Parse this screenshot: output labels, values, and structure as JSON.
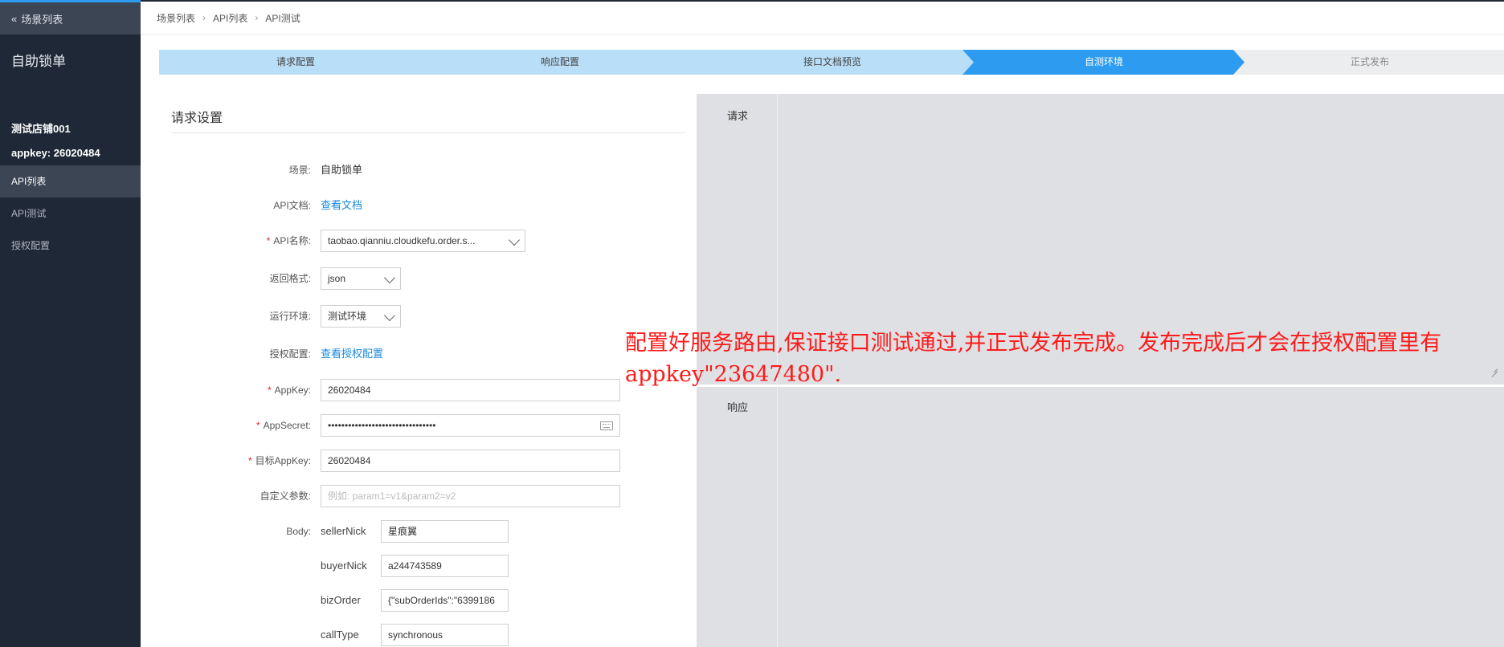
{
  "sidebar": {
    "back_label": "场景列表",
    "scene_title": "自助锁单",
    "store_name": "测试店铺001",
    "appkey_text": "appkey: 26020484",
    "items": [
      {
        "label": "API列表",
        "active": true
      },
      {
        "label": "API测试",
        "active": false
      },
      {
        "label": "授权配置",
        "active": false
      }
    ]
  },
  "breadcrumb": [
    "场景列表",
    "API列表",
    "API测试"
  ],
  "steps": [
    {
      "label": "请求配置",
      "state": "done"
    },
    {
      "label": "响应配置",
      "state": "done"
    },
    {
      "label": "接口文档预览",
      "state": "done"
    },
    {
      "label": "自测环境",
      "state": "active"
    },
    {
      "label": "正式发布",
      "state": "pending"
    }
  ],
  "form": {
    "heading": "请求设置",
    "scene": {
      "label": "场景:",
      "value": "自助锁单"
    },
    "api_doc": {
      "label": "API文档:",
      "link": "查看文档"
    },
    "api_name": {
      "label": "API名称:",
      "value": "taobao.qianniu.cloudkefu.order.s..."
    },
    "return_format": {
      "label": "返回格式:",
      "value": "json"
    },
    "run_env": {
      "label": "运行环境:",
      "value": "测试环境"
    },
    "auth_config": {
      "label": "授权配置:",
      "link": "查看授权配置"
    },
    "appkey": {
      "label": "AppKey:",
      "value": "26020484"
    },
    "appsecret": {
      "label": "AppSecret:",
      "value": "••••••••••••••••••••••••••••••••"
    },
    "target_appkey": {
      "label": "目标AppKey:",
      "value": "26020484"
    },
    "custom_params": {
      "label": "自定义参数:",
      "placeholder": "例如: param1=v1&param2=v2"
    },
    "body": {
      "label": "Body:",
      "fields": [
        {
          "key": "sellerNick",
          "value": "星痕翼"
        },
        {
          "key": "buyerNick",
          "value": "a244743589"
        },
        {
          "key": "bizOrder",
          "value": "{\"subOrderIds\":\"6399186"
        },
        {
          "key": "callType",
          "value": "synchronous"
        }
      ]
    }
  },
  "panel": {
    "request_label": "请求",
    "response_label": "响应"
  },
  "annotation": {
    "text": "配置好服务路由,保证接口测试通过,并正式发布完成。发布完成后才会在授权配置里有appkey\"23647480\".",
    "color": "#ff1a1a"
  },
  "colors": {
    "sidebar_bg": "#1f2836",
    "accent": "#2d9cf0",
    "step_done": "#b9def8",
    "required": "#e02020"
  }
}
